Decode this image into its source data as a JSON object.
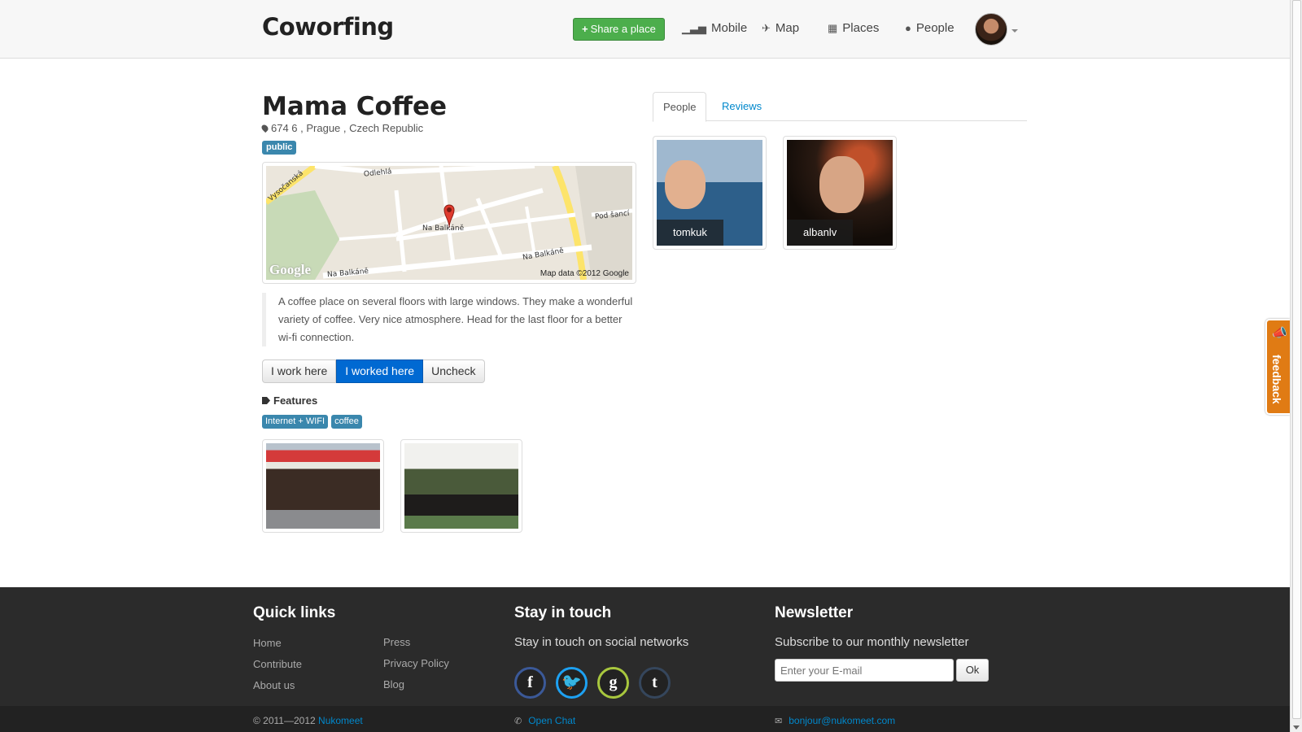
{
  "navbar": {
    "brand": "Coworfing",
    "share_label": "Share a place",
    "items": [
      {
        "label": "Mobile",
        "icon": "signal-icon"
      },
      {
        "label": "Map",
        "icon": "map-icon"
      },
      {
        "label": "Places",
        "icon": "grid-icon"
      },
      {
        "label": "People",
        "icon": "user-icon"
      }
    ]
  },
  "place": {
    "title": "Mama Coffee",
    "address": "674 6 , Prague , Czech Republic",
    "badge": "public",
    "map": {
      "streets": [
        "Odlehlá",
        "Vysočanská",
        "Na Balkáně",
        "Pod šancí",
        "Na Balkáně",
        "Na Balkáně"
      ],
      "credit": "Map data ©2012 Google",
      "logo": "Google"
    },
    "description": "A coffee place on several floors with large windows. They make a wonderful variety of coffee. Very nice atmosphere. Head for the last floor for a better wi-fi connection."
  },
  "actions": {
    "work_here": "I work here",
    "worked_here": "I worked here",
    "uncheck": "Uncheck"
  },
  "features": {
    "title": "Features",
    "tags": [
      "Internet + WIFI",
      "coffee"
    ]
  },
  "tabs": {
    "people": "People",
    "reviews": "Reviews"
  },
  "people": [
    {
      "name": "tomkuk"
    },
    {
      "name": "albanlv"
    }
  ],
  "feedback": {
    "label": "feedback"
  },
  "footer": {
    "quick_links": {
      "title": "Quick links",
      "col1": [
        "Home",
        "Contribute",
        "About us"
      ],
      "col2": [
        "Press",
        "Privacy Policy",
        "Blog"
      ]
    },
    "stay_in_touch": {
      "title": "Stay in touch",
      "text": "Stay in touch on social networks",
      "networks": [
        "facebook",
        "twitter",
        "google",
        "tumblr"
      ]
    },
    "newsletter": {
      "title": "Newsletter",
      "text": "Subscribe to our monthly newsletter",
      "placeholder": "Enter your E-mail",
      "ok": "Ok"
    },
    "copyright": "© 2011—2012",
    "company": "Nukomeet",
    "chat": "Open Chat",
    "email": "bonjour@nukomeet.com"
  },
  "colors": {
    "share_green": "#4cae4c",
    "badge_blue": "#3a87ad",
    "active_button": "#0069d2",
    "feedback_orange": "#e07b14",
    "footer_bg": "#2b2b2b",
    "link": "#0088cc"
  }
}
